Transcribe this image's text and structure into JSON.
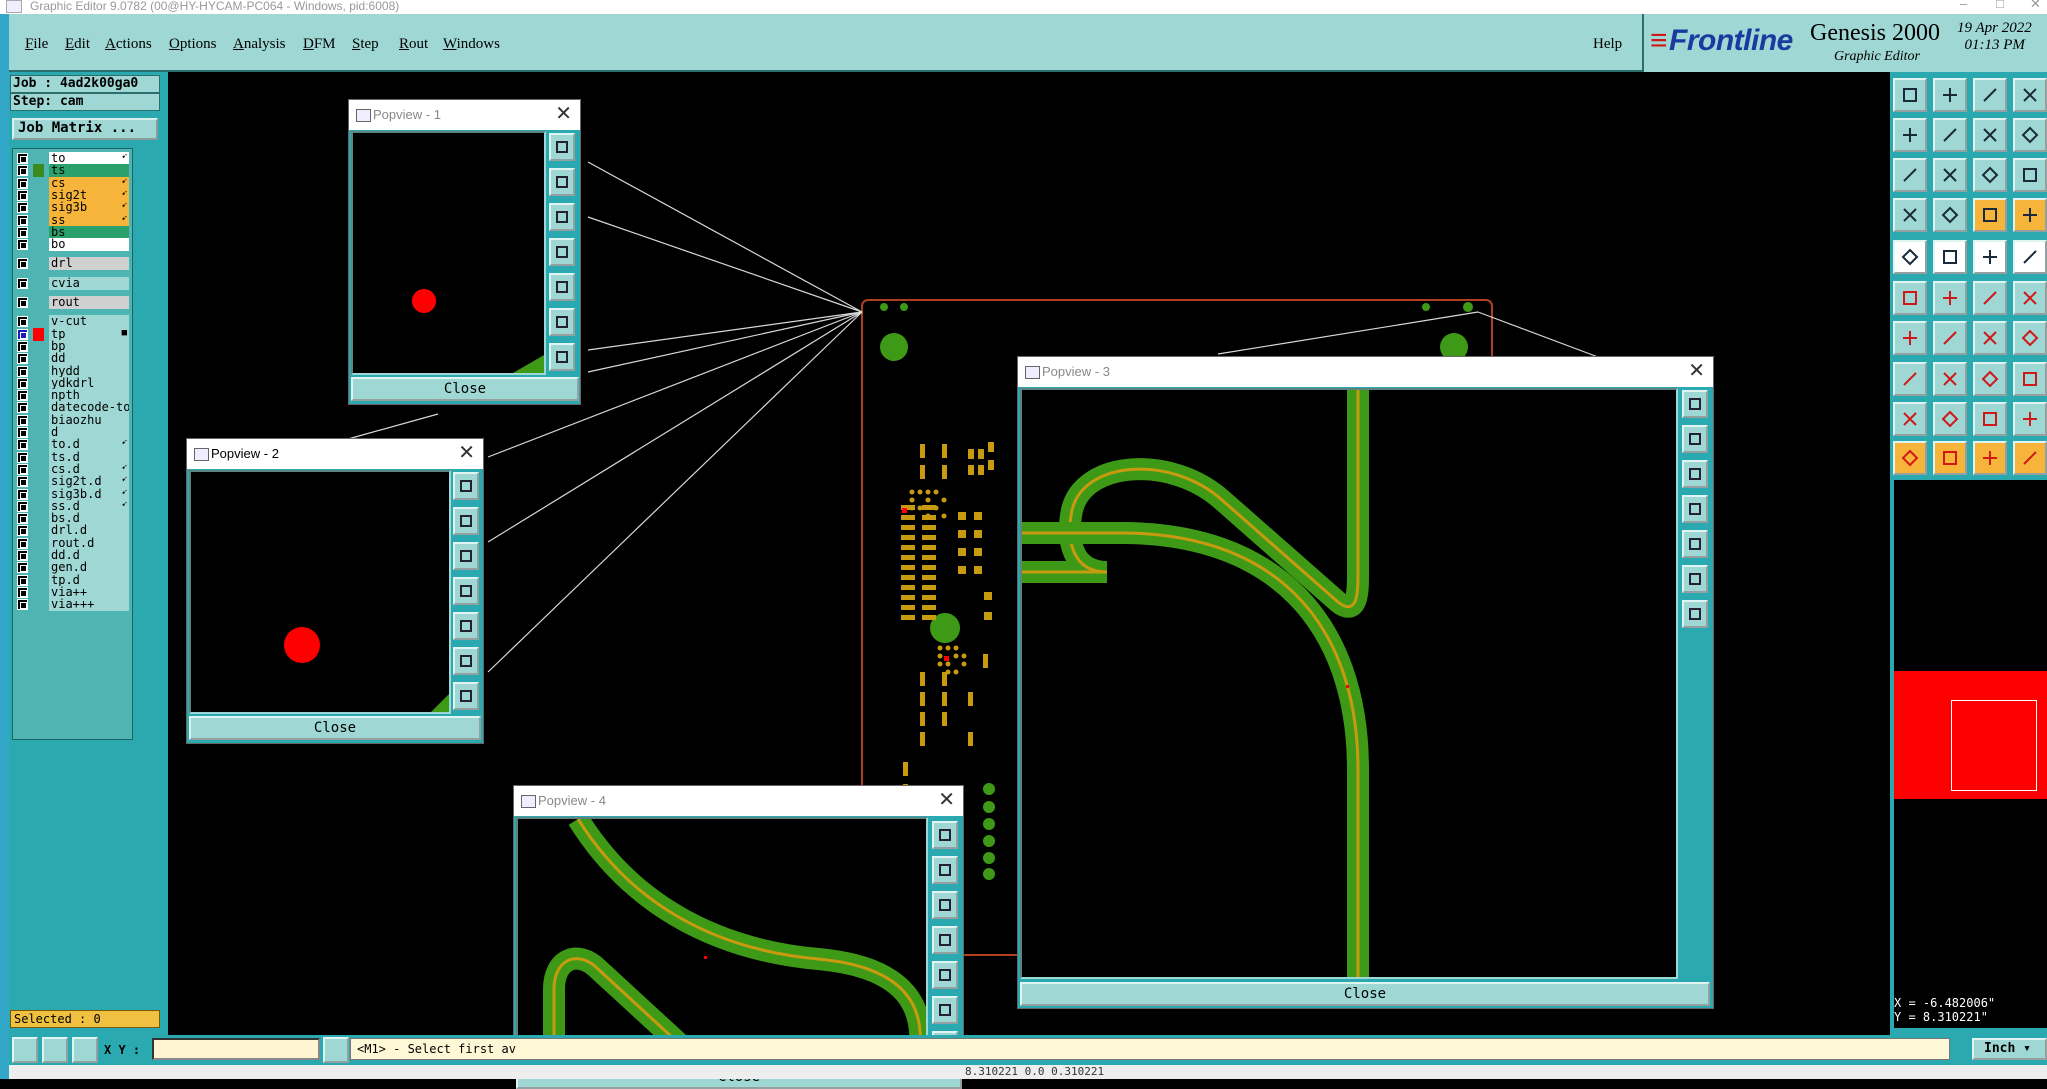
{
  "window": {
    "title": "Graphic Editor 9.0782 (00@HY-HYCAM-PC064 - Windows, pid:6008)"
  },
  "menu": {
    "items": [
      "File",
      "Edit",
      "Actions",
      "Options",
      "Analysis",
      "DFM",
      "Step",
      "Rout",
      "Windows"
    ],
    "help": "Help"
  },
  "branding": {
    "logo": "Frontline",
    "product": "Genesis 2000",
    "subtitle": "Graphic Editor",
    "date": "19 Apr 2022",
    "time": "01:13 PM"
  },
  "job": {
    "job_label": "Job : 4ad2k00ga0",
    "step_label": "Step: cam",
    "job_matrix_button": "Job Matrix ..."
  },
  "layers": [
    {
      "name": "to",
      "color": "#ffffff",
      "board": true,
      "arrow": true
    },
    {
      "name": "ts",
      "color": "#2aa06a",
      "board": true,
      "swatch": "#3a8a20"
    },
    {
      "name": "cs",
      "color": "#f6b43a",
      "board": true,
      "arrow": true
    },
    {
      "name": "sig2t",
      "color": "#f6b43a",
      "board": true,
      "arrow": true
    },
    {
      "name": "sig3b",
      "color": "#f6b43a",
      "board": true,
      "arrow": true
    },
    {
      "name": "ss",
      "color": "#f6b43a",
      "board": true,
      "arrow": true
    },
    {
      "name": "bs",
      "color": "#2aa06a",
      "board": true
    },
    {
      "name": "bo",
      "color": "#ffffff",
      "board": true
    },
    {
      "name": "drl",
      "color": "#d0d0d0",
      "board": true
    },
    {
      "name": "cvia",
      "color": "#9ed7d4",
      "board": true
    },
    {
      "name": "rout",
      "color": "#d0d0d0",
      "board": true
    },
    {
      "name": "v-cut",
      "color": "#9ed7d4"
    },
    {
      "name": "tp",
      "color": "#9ed7d4",
      "swatch": "#ff0000",
      "active": true,
      "arrow": true
    },
    {
      "name": "bp",
      "color": "#9ed7d4"
    },
    {
      "name": "dd",
      "color": "#9ed7d4"
    },
    {
      "name": "hydd",
      "color": "#9ed7d4"
    },
    {
      "name": "ydkdrl",
      "color": "#9ed7d4"
    },
    {
      "name": "npth",
      "color": "#9ed7d4"
    },
    {
      "name": "datecode-to",
      "color": "#9ed7d4"
    },
    {
      "name": "biaozhu",
      "color": "#9ed7d4"
    },
    {
      "name": "d",
      "color": "#9ed7d4"
    },
    {
      "name": "to.d",
      "color": "#9ed7d4",
      "arrow": true
    },
    {
      "name": "ts.d",
      "color": "#9ed7d4"
    },
    {
      "name": "cs.d",
      "color": "#9ed7d4",
      "arrow": true
    },
    {
      "name": "sig2t.d",
      "color": "#9ed7d4",
      "arrow": true
    },
    {
      "name": "sig3b.d",
      "color": "#9ed7d4",
      "arrow": true
    },
    {
      "name": "ss.d",
      "color": "#9ed7d4",
      "arrow": true
    },
    {
      "name": "bs.d",
      "color": "#9ed7d4"
    },
    {
      "name": "drl.d",
      "color": "#9ed7d4"
    },
    {
      "name": "rout.d",
      "color": "#9ed7d4"
    },
    {
      "name": "dd.d",
      "color": "#9ed7d4"
    },
    {
      "name": "gen.d",
      "color": "#9ed7d4"
    },
    {
      "name": "tp.d",
      "color": "#9ed7d4"
    },
    {
      "name": "via++",
      "color": "#9ed7d4"
    },
    {
      "name": "via+++",
      "color": "#9ed7d4"
    }
  ],
  "status": {
    "selected": "Selected : 0",
    "xy_label": "X Y :",
    "xy_value": "",
    "prompt": "<M1> - Select first av",
    "unit": "Inch",
    "coord_x": "X = -6.482006\"",
    "coord_y": "Y = 8.310221\"",
    "secondary": "8.310221 0.0 0.310221"
  },
  "popviews": [
    {
      "title": "Popview - 1",
      "close_label": "Close"
    },
    {
      "title": "Popview - 2",
      "close_label": "Close"
    },
    {
      "title": "Popview - 3",
      "close_label": "Close"
    },
    {
      "title": "Popview - 4",
      "close_label": "Close"
    }
  ],
  "colors": {
    "panel_teal": "#2aa9b0",
    "widget_light": "#9ed7d4",
    "trace_green": "#3e9a16",
    "trace_gold": "#c89a10",
    "marker_red": "#ff0000"
  }
}
